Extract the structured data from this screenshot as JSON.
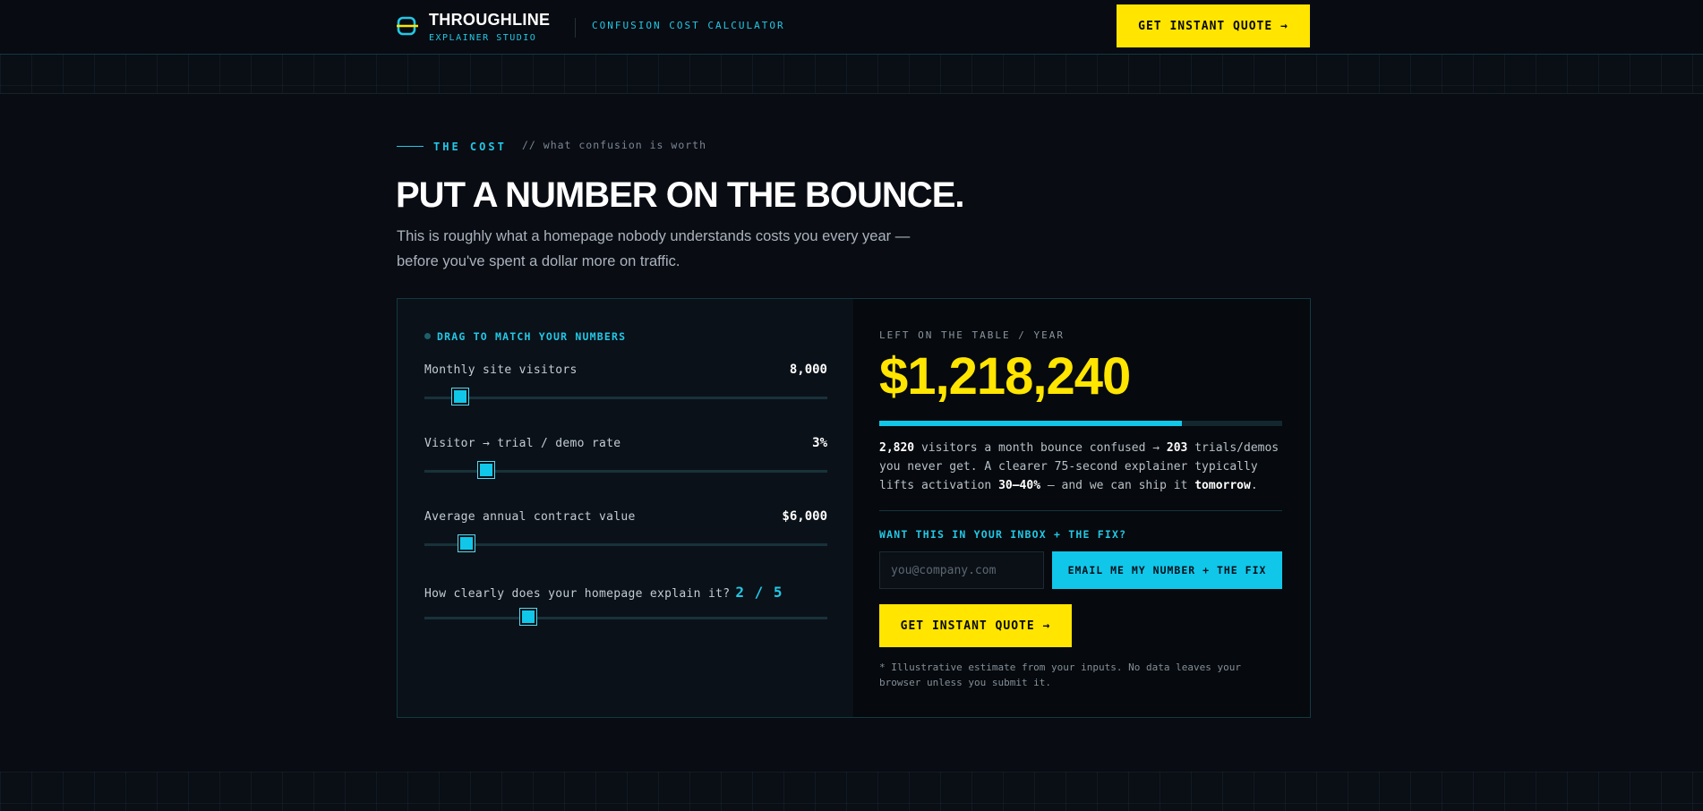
{
  "header": {
    "brand_name": "THROUGHLINE",
    "brand_sub": "EXPLAINER STUDIO",
    "tag": "CONFUSION COST CALCULATOR",
    "cta_label": "GET INSTANT QUOTE →"
  },
  "intro": {
    "eyebrow": "THE COST",
    "eyebrow_note": "// what confusion is worth",
    "headline": "PUT A NUMBER ON THE BOUNCE.",
    "subhead": "This is roughly what a homepage nobody understands costs you every year — before you've spent a dollar more on traffic."
  },
  "calculator": {
    "drag_label": "DRAG TO MATCH YOUR NUMBERS",
    "sliders": [
      {
        "label": "Monthly site visitors",
        "value": "8,000",
        "fraction": 0.09
      },
      {
        "label": "Visitor → trial / demo rate",
        "value": "3%",
        "fraction": 0.155
      },
      {
        "label": "Average annual contract value",
        "value": "$6,000",
        "fraction": 0.107
      },
      {
        "label": "How clearly does your homepage explain it?",
        "value": "2 / 5",
        "fraction": 0.26
      }
    ]
  },
  "result": {
    "label": "LEFT ON THE TABLE / YEAR",
    "amount": "$1,218,240",
    "progress_fraction": 0.75,
    "summary": {
      "visitors": "2,820",
      "t1": " visitors a month bounce confused → ",
      "trials": "203",
      "t2": " trials/demos you never get. A clearer 75-second explainer typically lifts activation ",
      "lift": "30–40%",
      "t3": " — and we can ship it ",
      "ship": "tomorrow",
      "t4": "."
    },
    "inbox_question": "WANT THIS IN YOUR INBOX + THE FIX?",
    "email_placeholder": "you@company.com",
    "email_button": "EMAIL ME MY NUMBER + THE FIX",
    "quote_button": "GET INSTANT QUOTE →",
    "footnote": "* Illustrative estimate from your inputs. No data leaves your browser unless you submit it."
  },
  "colors": {
    "accent_cyan": "#10c7ea",
    "accent_yellow": "#ffe500",
    "background": "#090c13"
  },
  "icons": {
    "logo": "throughline-logo-icon"
  }
}
